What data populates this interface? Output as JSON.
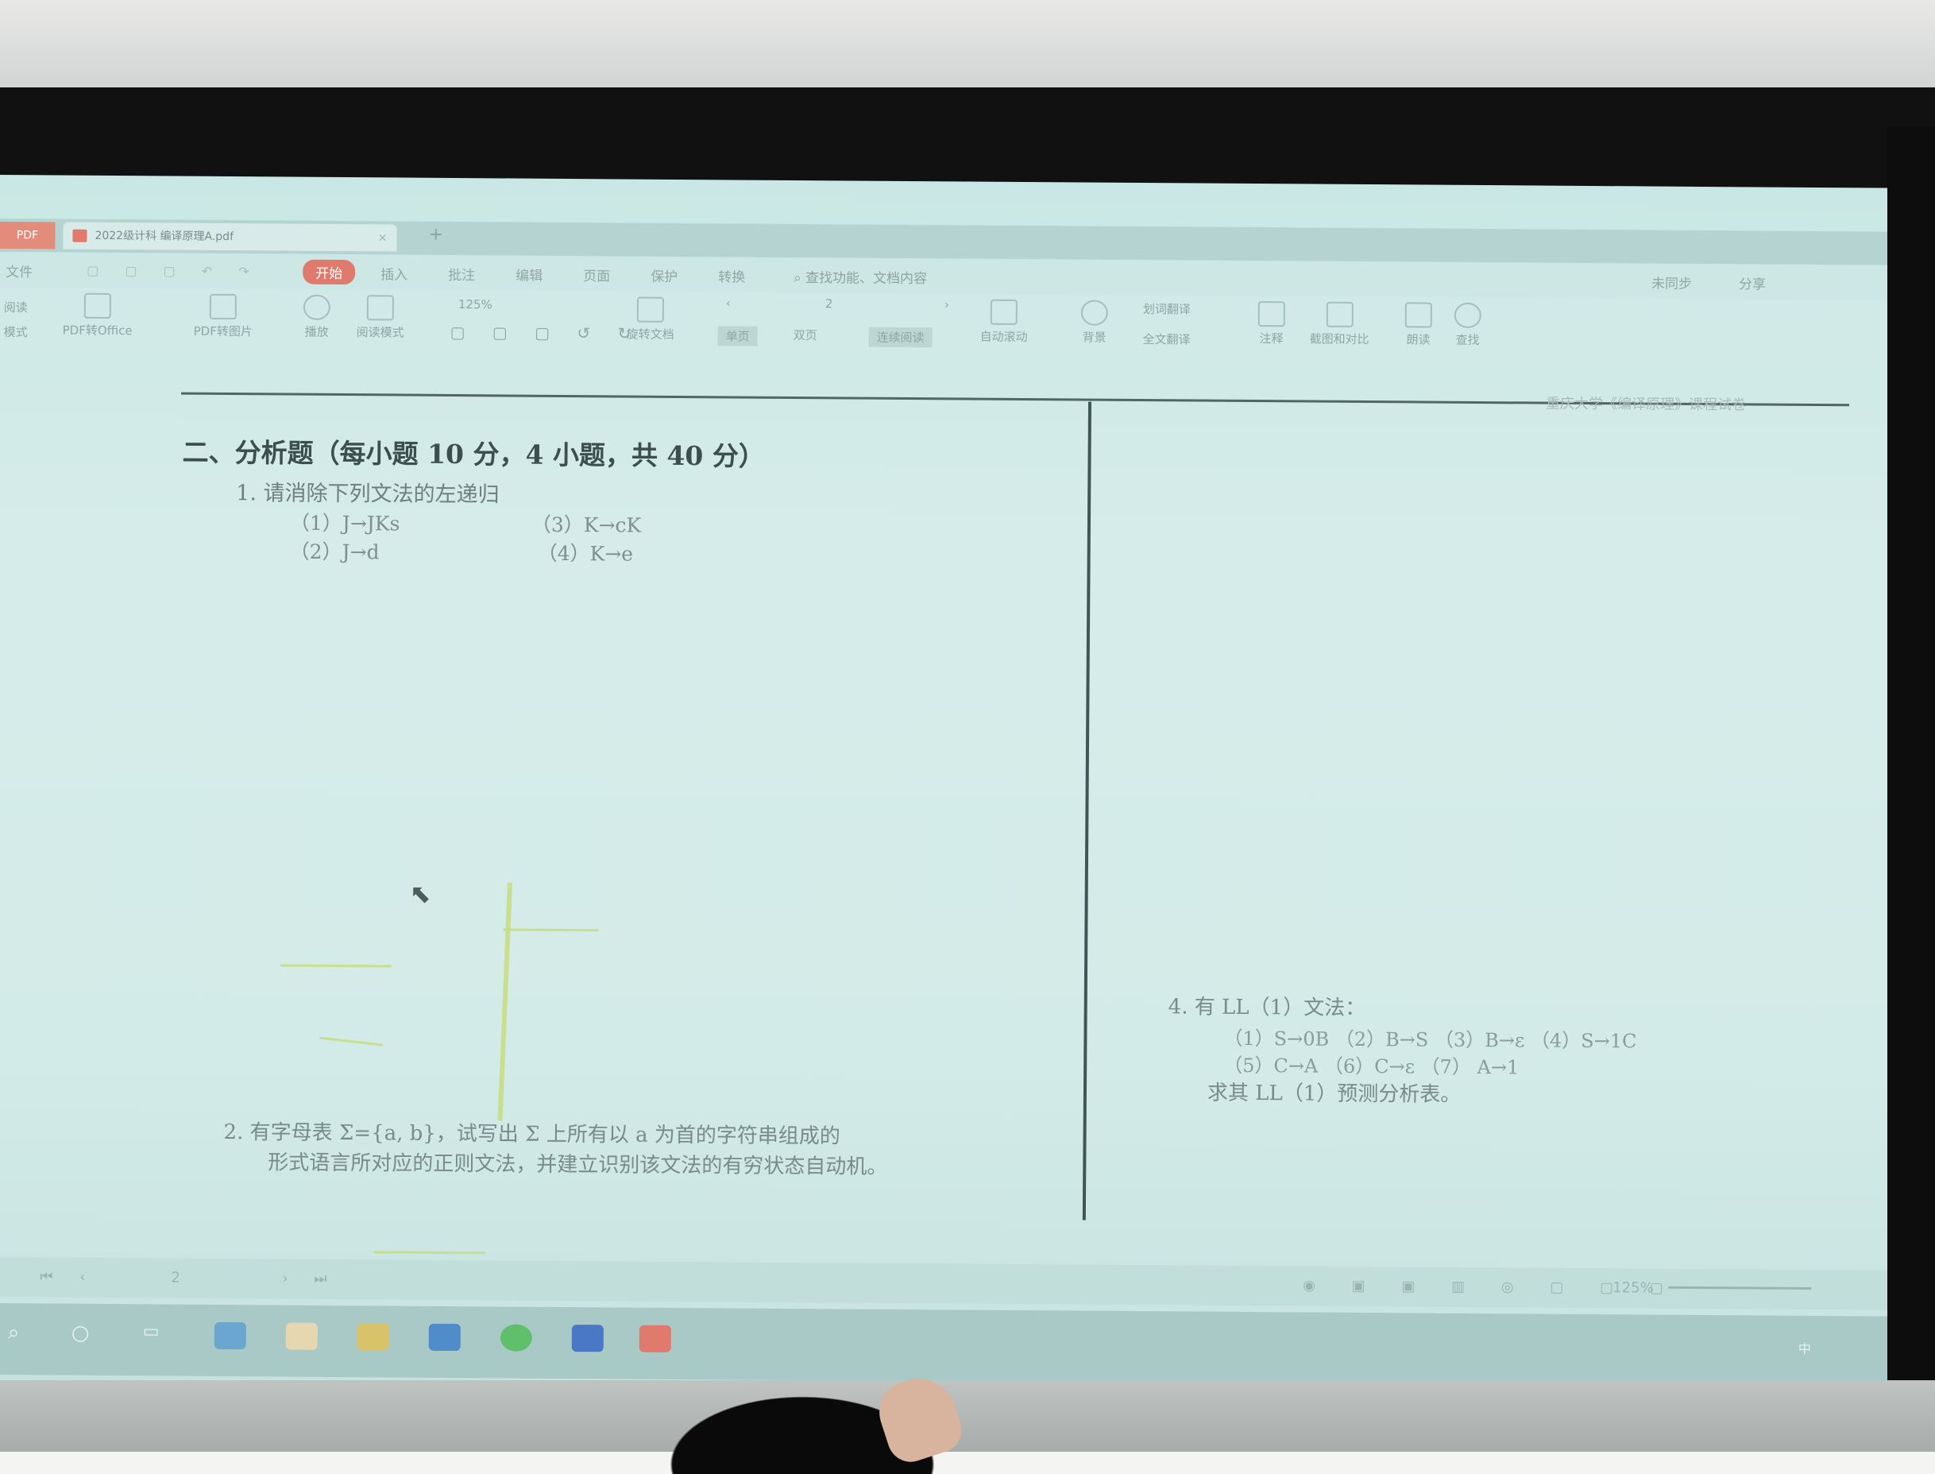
{
  "window": {
    "pdf_tab_label": "PDF",
    "document_tab_label": "2022级计科 编译原理A.pdf"
  },
  "menu": {
    "file": "文件",
    "items": [
      "开始",
      "插入",
      "批注",
      "编辑",
      "页面",
      "保护",
      "转换"
    ],
    "search_placeholder": "查找功能、文档内容",
    "sync": "未同步",
    "share": "分享"
  },
  "toolbar": {
    "side_labels": [
      "阅读",
      "模式"
    ],
    "buttons": [
      "PDF转Office",
      "PDF转图片",
      "播放",
      "阅读模式",
      "旋转文档",
      "自动滚动",
      "背景",
      "划词翻译",
      "全文翻译",
      "注释",
      "截图和对比",
      "朗读",
      "查找"
    ],
    "zoom": "125%",
    "page_number": "2",
    "view_single": "单页",
    "view_double": "双页",
    "view_continuous": "连续阅读"
  },
  "document": {
    "running_head": "重庆大学《编译原理》课程试卷",
    "section_title": "二、分析题（每小题 10 分，4 小题，共 40 分）",
    "q1_title": "1.  请消除下列文法的左递归",
    "q1_productions": [
      "（1）J→JKs",
      "（3）K→cK",
      "（2）J→d",
      "（4）K→e"
    ],
    "q2_line1": "2.  有字母表 Σ={a, b}，试写出 Σ 上所有以 a 为首的字符串组成的",
    "q2_line2": "形式语言所对应的正则文法，并建立识别该文法的有穷状态自动机。",
    "q4_title": "4.  有 LL（1）文法：",
    "q4_row1": "（1）S→0B    （2）B→S    （3）B→ε        （4）S→1C",
    "q4_row2": "（5）C→A    （6）C→ε    （7）  A→1",
    "q4_ask": "求其 LL（1）预测分析表。"
  },
  "statusbar": {
    "page": "2",
    "zoom": "125%"
  },
  "taskbar": {
    "ime": "中"
  }
}
